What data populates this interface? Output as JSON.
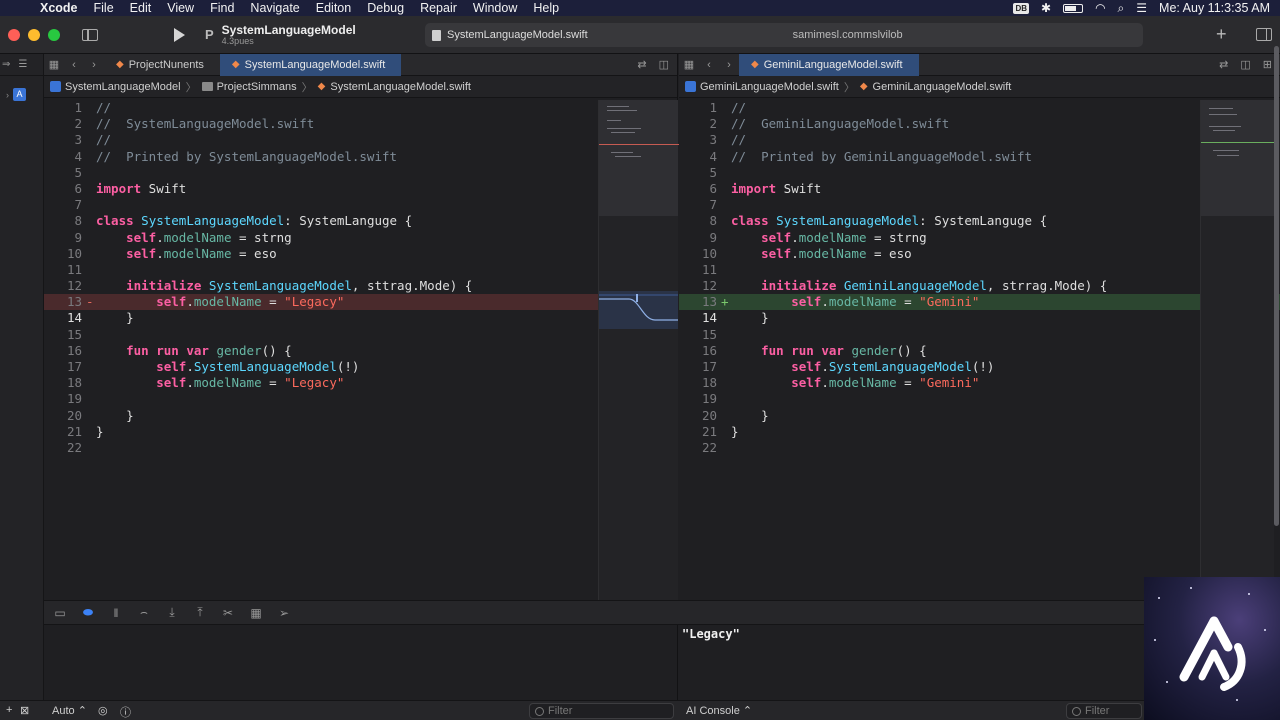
{
  "menubar": {
    "app": "Xcode",
    "items": [
      "File",
      "Edit",
      "View",
      "Find",
      "Navigate",
      "Editon",
      "Debug",
      "Repair",
      "Window",
      "Help"
    ],
    "badge": "DB",
    "clock": "Me: Auy 11:3:35 AM"
  },
  "toolbar": {
    "scheme_title": "SystemLanguageModel",
    "scheme_sub": "4.3pues",
    "activity_file": "SystemLanguageModel.swift",
    "activity_status": "samimesl.commslvilob"
  },
  "left": {
    "tabs": [
      {
        "label": "ProjectNunents",
        "active": false
      },
      {
        "label": "SystemLanguageModel.swift",
        "active": true
      }
    ],
    "breadcrumb": [
      "SystemLanguageModel",
      "ProjectSimmans",
      "SystemLanguageModel.swift"
    ],
    "lines": [
      {
        "n": "1",
        "m": "",
        "t": "//",
        "state": ""
      },
      {
        "n": "2",
        "m": "",
        "t": "//  SystemLanguageModel.swift",
        "state": ""
      },
      {
        "n": "3",
        "m": "",
        "t": "//",
        "state": ""
      },
      {
        "n": "4",
        "m": "",
        "t": "//  Printed by SystemLanguageModel.swift",
        "state": ""
      },
      {
        "n": "5",
        "m": "",
        "t": "",
        "state": ""
      },
      {
        "n": "6",
        "m": "",
        "t": "import Swift",
        "state": ""
      },
      {
        "n": "7",
        "m": "",
        "t": "",
        "state": ""
      },
      {
        "n": "8",
        "m": "",
        "t": "class SystemLanguageModel: SystemLanguge {",
        "state": ""
      },
      {
        "n": "9",
        "m": "",
        "t": "    self.modelName = strng",
        "state": ""
      },
      {
        "n": "10",
        "m": "",
        "t": "    self.modelName = eso",
        "state": ""
      },
      {
        "n": "11",
        "m": "",
        "t": "",
        "state": ""
      },
      {
        "n": "12",
        "m": "",
        "t": "    initialize SystemLanguageModel, sttrag.Mode) {",
        "state": ""
      },
      {
        "n": "13",
        "m": "-",
        "t": "        self.modelName = \"Legacy\"",
        "state": "removed"
      },
      {
        "n": "14",
        "m": "",
        "t": "    }",
        "state": "current"
      },
      {
        "n": "15",
        "m": "",
        "t": "",
        "state": ""
      },
      {
        "n": "16",
        "m": "",
        "t": "    fun run var gender() {",
        "state": ""
      },
      {
        "n": "17",
        "m": "",
        "t": "        self.SystemLanguageModel(!)",
        "state": ""
      },
      {
        "n": "18",
        "m": "",
        "t": "        self.modelName = \"Legacy\"",
        "state": ""
      },
      {
        "n": "19",
        "m": "",
        "t": "",
        "state": ""
      },
      {
        "n": "20",
        "m": "",
        "t": "    }",
        "state": ""
      },
      {
        "n": "21",
        "m": "",
        "t": "}",
        "state": ""
      },
      {
        "n": "22",
        "m": "",
        "t": "",
        "state": ""
      }
    ]
  },
  "right": {
    "tabs": [
      {
        "label": "GeminiLanguageModel.swift",
        "active": true
      }
    ],
    "breadcrumb": [
      "GeminiLanguageModel.swift",
      "GeminiLanguageModel.swift"
    ],
    "lines": [
      {
        "n": "1",
        "m": "",
        "t": "//",
        "state": ""
      },
      {
        "n": "2",
        "m": "",
        "t": "//  GeminiLanguageModel.swift",
        "state": ""
      },
      {
        "n": "3",
        "m": "",
        "t": "//",
        "state": ""
      },
      {
        "n": "4",
        "m": "",
        "t": "//  Printed by GeminiLanguageModel.swift",
        "state": ""
      },
      {
        "n": "5",
        "m": "",
        "t": "",
        "state": ""
      },
      {
        "n": "6",
        "m": "",
        "t": "import Swift",
        "state": ""
      },
      {
        "n": "7",
        "m": "",
        "t": "",
        "state": ""
      },
      {
        "n": "8",
        "m": "",
        "t": "class SystemLanguageModel: SystemLanguge {",
        "state": ""
      },
      {
        "n": "9",
        "m": "",
        "t": "    self.modelName = strng",
        "state": ""
      },
      {
        "n": "10",
        "m": "",
        "t": "    self.modelName = eso",
        "state": ""
      },
      {
        "n": "11",
        "m": "",
        "t": "",
        "state": ""
      },
      {
        "n": "12",
        "m": "",
        "t": "    initialize GeminiLanguageModel, strrag.Mode) {",
        "state": ""
      },
      {
        "n": "13",
        "m": "+",
        "t": "        self.modelName = \"Gemini\"",
        "state": "added"
      },
      {
        "n": "14",
        "m": "",
        "t": "    }",
        "state": "current"
      },
      {
        "n": "15",
        "m": "",
        "t": "",
        "state": ""
      },
      {
        "n": "16",
        "m": "",
        "t": "    fun run var gender() {",
        "state": ""
      },
      {
        "n": "17",
        "m": "",
        "t": "        self.SystemLanguageModel(!)",
        "state": ""
      },
      {
        "n": "18",
        "m": "",
        "t": "        self.modelName = \"Gemini\"",
        "state": ""
      },
      {
        "n": "19",
        "m": "",
        "t": "",
        "state": ""
      },
      {
        "n": "20",
        "m": "",
        "t": "    }",
        "state": ""
      },
      {
        "n": "21",
        "m": "",
        "t": "}",
        "state": ""
      },
      {
        "n": "22",
        "m": "",
        "t": "",
        "state": ""
      }
    ]
  },
  "debug": {
    "console_output": "\"Legacy\"",
    "auto_label": "Auto",
    "console_label": "AI Console",
    "filter_placeholder": "Filter"
  },
  "colors": {
    "removed": "#4a2a2c",
    "added": "#2c4630",
    "active_tab": "#304d7a",
    "keyword": "#fc5fa3",
    "string": "#fc6a5d",
    "type": "#5dd8ff"
  }
}
